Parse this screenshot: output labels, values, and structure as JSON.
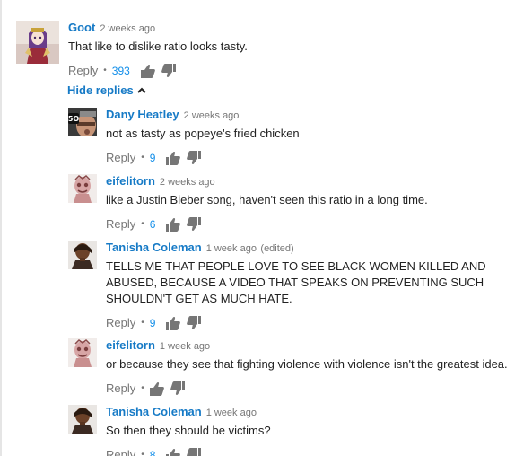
{
  "comment": {
    "author": "Goot",
    "time": "2 weeks ago",
    "text": "That like to dislike ratio looks tasty.",
    "reply_label": "Reply",
    "likes": "393"
  },
  "hide_replies_label": "Hide replies",
  "replies": [
    {
      "author": "Dany Heatley",
      "time": "2 weeks ago",
      "text": "not as tasty as popeye's fried chicken",
      "reply_label": "Reply",
      "likes": "9"
    },
    {
      "author": "eifelitorn",
      "time": "2 weeks ago",
      "text": "like a Justin Bieber song, haven't seen this ratio in a long time.",
      "reply_label": "Reply",
      "likes": "6"
    },
    {
      "author": "Tanisha Coleman",
      "time": "1 week ago",
      "edited": "(edited)",
      "text": "TELLS ME THAT PEOPLE LOVE TO SEE BLACK WOMEN KILLED AND ABUSED, BECAUSE A VIDEO THAT SPEAKS ON PREVENTING SUCH SHOULDN'T GET AS MUCH HATE.",
      "reply_label": "Reply",
      "likes": "9"
    },
    {
      "author": "eifelitorn",
      "time": "1 week ago",
      "text": "or because they see that fighting violence with violence isn't the greatest idea.",
      "reply_label": "Reply",
      "likes": ""
    },
    {
      "author": "Tanisha Coleman",
      "time": "1 week ago",
      "text": "So then they should be victims?",
      "reply_label": "Reply",
      "likes": "8"
    }
  ],
  "icons": {
    "like": "thumbs-up-icon",
    "dislike": "thumbs-down-icon",
    "collapse": "chevron-up-icon"
  },
  "colors": {
    "link": "#167ac6",
    "count": "#128ee9",
    "meta": "#767676",
    "text": "#222222"
  }
}
